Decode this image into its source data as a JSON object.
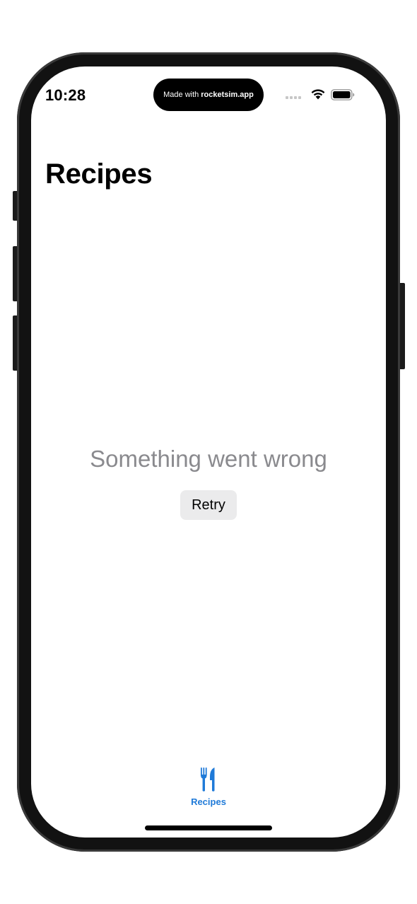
{
  "status_bar": {
    "time": "10:28",
    "island_prefix": "Made with",
    "island_brand": "rocketsim.app"
  },
  "page": {
    "title": "Recipes",
    "error_message": "Something went wrong",
    "retry_label": "Retry"
  },
  "tab_bar": {
    "items": [
      {
        "label": "Recipes",
        "icon": "fork-knife-icon",
        "selected": true
      }
    ]
  },
  "colors": {
    "accent": "#1f7ad8",
    "secondary_text": "#8a8a8e",
    "button_bg": "#ebebec"
  }
}
